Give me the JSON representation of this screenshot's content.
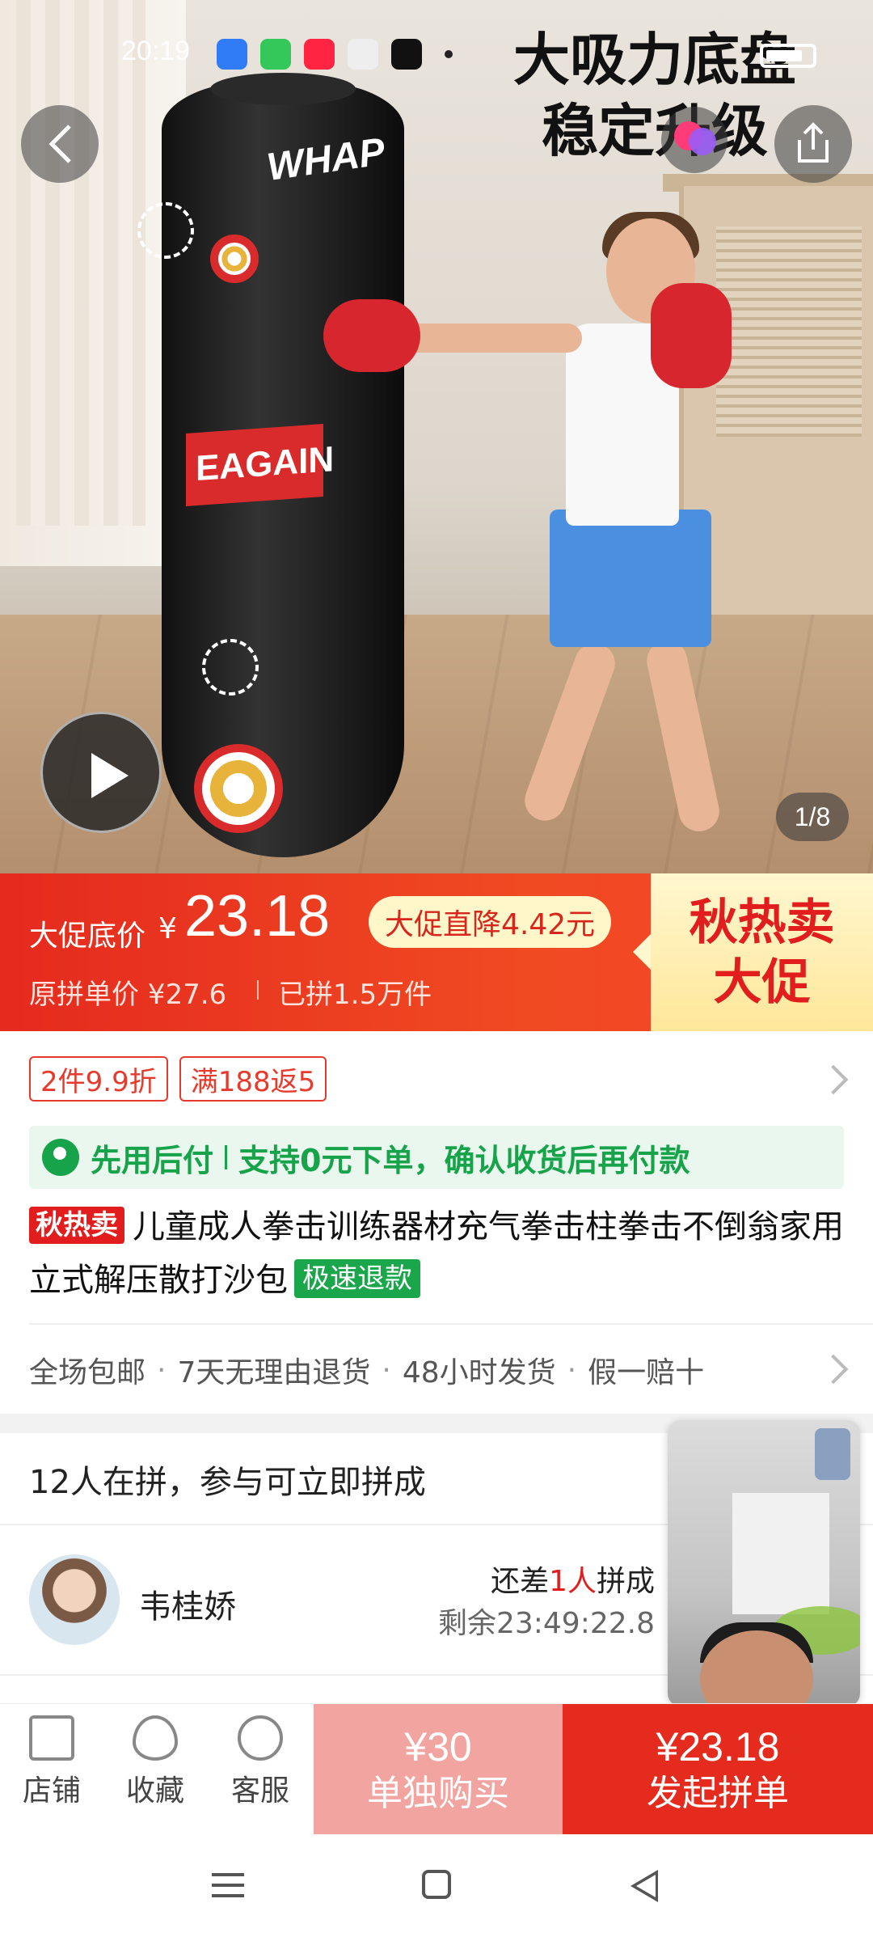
{
  "status_bar": {
    "time": "20:19"
  },
  "hero": {
    "promo_line1": "大吸力底盘",
    "promo_line2": "稳定升级",
    "bag_logo": "WHAP",
    "bag_slogan": "EAGAIN",
    "image_counter": "1/8"
  },
  "price": {
    "label": "大促底价",
    "currency": "¥",
    "value": "23.18",
    "drop_badge": "大促直降4.42元",
    "original": "原拼单价 ¥27.6",
    "sold": "已拼1.5万件",
    "promo_line1": "秋热卖",
    "promo_line2": "大促"
  },
  "coupons": [
    "2件9.9折",
    "满188返5"
  ],
  "pay_later": {
    "title": "先用后付",
    "desc": "支持0元下单，确认收货后再付款"
  },
  "product": {
    "hot_tag": "秋热卖",
    "title": "儿童成人拳击训练器材充气拳击柱拳击不倒翁家用立式解压散打沙包",
    "refund_tag": "极速退款"
  },
  "services": [
    "全场包邮",
    "7天无理由退货",
    "48小时发货",
    "假一赔十"
  ],
  "group_buy": {
    "heading": "12人在拼，参与可立即拼成",
    "user_name": "韦桂娇",
    "need_prefix": "还差",
    "need_count": "1人",
    "need_suffix": "拼成",
    "remaining": "剩余23:49:22.8"
  },
  "bottom_bar": {
    "shop": "店铺",
    "favorite": "收藏",
    "service": "客服",
    "solo_price": "¥30",
    "solo_label": "单独购买",
    "group_price": "¥23.18",
    "group_label": "发起拼单"
  },
  "colors": {
    "brand_red": "#e52a1e",
    "pay_green": "#16a34a",
    "solo_button": "#f2a4a0"
  }
}
